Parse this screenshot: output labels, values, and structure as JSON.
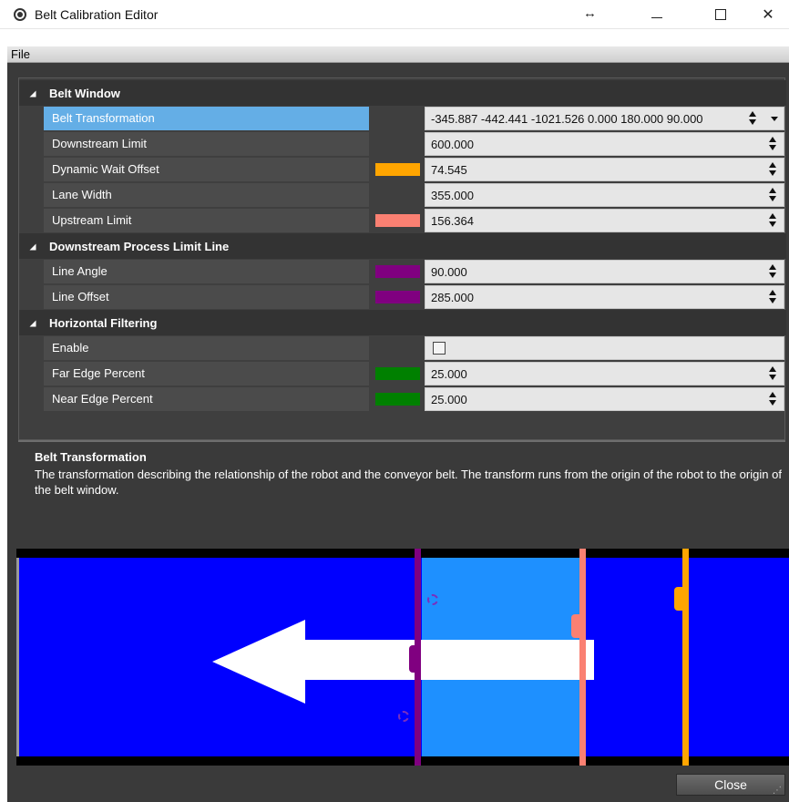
{
  "window": {
    "title": "Belt Calibration Editor",
    "resize_glyph": "↔",
    "close_glyph": "✕"
  },
  "menu": {
    "file": "File"
  },
  "sections": {
    "belt_window": "Belt Window",
    "downstream": "Downstream Process Limit Line",
    "horizontal": "Horizontal Filtering"
  },
  "properties": {
    "belt_transformation": {
      "label": "Belt Transformation",
      "value": "-345.887 -442.441 -1021.526 0.000 180.000 90.000"
    },
    "downstream_limit": {
      "label": "Downstream Limit",
      "value": "600.000"
    },
    "dynamic_wait_offset": {
      "label": "Dynamic Wait Offset",
      "value": "74.545",
      "color": "#ffa500"
    },
    "lane_width": {
      "label": "Lane Width",
      "value": "355.000"
    },
    "upstream_limit": {
      "label": "Upstream Limit",
      "value": "156.364",
      "color": "#fa8072"
    },
    "line_angle": {
      "label": "Line Angle",
      "value": "90.000",
      "color": "#800080"
    },
    "line_offset": {
      "label": "Line Offset",
      "value": "285.000",
      "color": "#800080"
    },
    "enable": {
      "label": "Enable",
      "checked": false
    },
    "far_edge_percent": {
      "label": "Far Edge Percent",
      "value": "25.000",
      "color": "#008000"
    },
    "near_edge_percent": {
      "label": "Near Edge Percent",
      "value": "25.000",
      "color": "#008000"
    }
  },
  "description": {
    "title": "Belt Transformation",
    "body": "The transformation describing the relationship of the robot and the conveyor belt. The transform runs from the origin of the robot to the origin of the belt window."
  },
  "visual": {
    "belt_color": "#0000ff",
    "window_color": "#1e90ff",
    "arrow_color": "#ffffff",
    "downstream_line_color": "#800080",
    "upstream_line_color": "#fa8072",
    "dynamic_wait_line_color": "#ffa500"
  },
  "buttons": {
    "close": "Close"
  }
}
